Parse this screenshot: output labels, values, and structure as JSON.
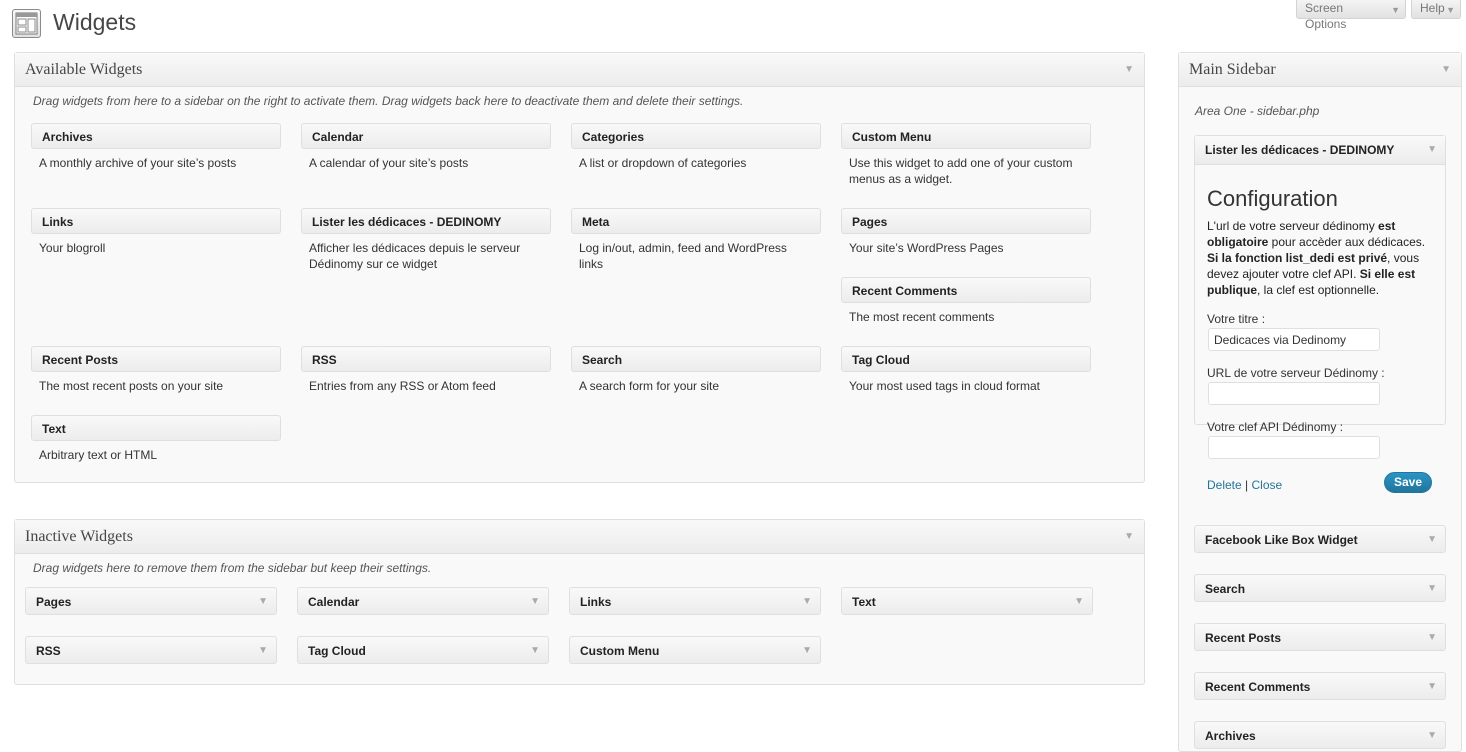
{
  "header": {
    "title": "Widgets",
    "screen_options": "Screen Options",
    "help": "Help"
  },
  "available": {
    "title": "Available Widgets",
    "description": "Drag widgets from here to a sidebar on the right to activate them. Drag widgets back here to deactivate them and delete their settings.",
    "widgets": [
      {
        "name": "Archives",
        "desc": "A monthly archive of your site’s posts"
      },
      {
        "name": "Calendar",
        "desc": "A calendar of your site’s posts"
      },
      {
        "name": "Categories",
        "desc": "A list or dropdown of categories"
      },
      {
        "name": "Custom Menu",
        "desc": "Use this widget to add one of your custom menus as a widget."
      },
      {
        "name": "Links",
        "desc": "Your blogroll"
      },
      {
        "name": "Lister les dédicaces - DEDINOMY",
        "desc": "Afficher les dédicaces depuis le serveur Dédinomy sur ce widget"
      },
      {
        "name": "Meta",
        "desc": "Log in/out, admin, feed and WordPress links"
      },
      {
        "name": "Pages",
        "desc": "Your site’s WordPress Pages"
      },
      {
        "name": "Recent Comments",
        "desc": "The most recent comments"
      },
      {
        "name": "Recent Posts",
        "desc": "The most recent posts on your site"
      },
      {
        "name": "RSS",
        "desc": "Entries from any RSS or Atom feed"
      },
      {
        "name": "Search",
        "desc": "A search form for your site"
      },
      {
        "name": "Tag Cloud",
        "desc": "Your most used tags in cloud format"
      },
      {
        "name": "Text",
        "desc": "Arbitrary text or HTML"
      }
    ]
  },
  "inactive": {
    "title": "Inactive Widgets",
    "description": "Drag widgets here to remove them from the sidebar but keep their settings.",
    "widgets": [
      "Pages",
      "Calendar",
      "Links",
      "Text",
      "RSS",
      "Tag Cloud",
      "Custom Menu"
    ]
  },
  "sidebar": {
    "title": "Main Sidebar",
    "area": "Area One - sidebar.php",
    "expanded_widget": {
      "title": "Lister les dédicaces - DEDINOMY",
      "config_title": "Configuration",
      "text_1": "L'url de votre serveur dédinomy ",
      "text_2": "est obligatoire",
      "text_3": " pour accèder aux dédicaces. ",
      "text_4": "Si la fonction list_dedi est privé",
      "text_5": ", vous devez ajouter votre clef API. ",
      "text_6": "Si elle est publique",
      "text_7": ", la clef est optionnelle.",
      "label_title": "Votre titre :",
      "value_title": "Dedicaces via Dedinomy",
      "label_url": "URL de votre serveur Dédinomy :",
      "value_url": "",
      "label_api": "Votre clef API Dédinomy :",
      "value_api": "",
      "delete": "Delete",
      "separator": "|",
      "close": "Close",
      "save": "Save"
    },
    "widgets": [
      "Facebook Like Box Widget",
      "Search",
      "Recent Posts",
      "Recent Comments",
      "Archives"
    ]
  },
  "icons": {
    "arrow": "▼",
    "top_arrow": "▼"
  },
  "colors": {
    "link": "#21759b",
    "save_button": "#21759b"
  }
}
